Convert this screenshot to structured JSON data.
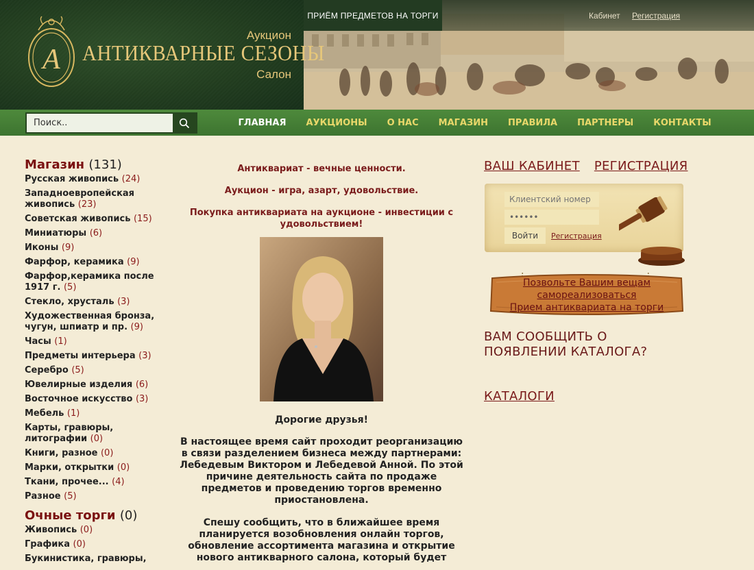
{
  "header": {
    "brand_top": "Аукцион",
    "brand_name": "АНТИКВАРНЫЕ СЕЗОНЫ",
    "brand_bottom": "Салон",
    "auction_link": "ПРИЁМ ПРЕДМЕТОВ НА ТОРГИ",
    "cabinet_link": "Кабинет",
    "register_link": "Регистрация"
  },
  "search": {
    "placeholder": "Поиск.."
  },
  "nav": {
    "items": [
      "ГЛАВНАЯ",
      "АУКЦИОНЫ",
      "О НАС",
      "МАГАЗИН",
      "ПРАВИЛА",
      "ПАРТНЕРЫ",
      "КОНТАКТЫ"
    ]
  },
  "sidebar": {
    "shop": {
      "title": "Магазин",
      "count": "(131)",
      "items": [
        {
          "label": "Русская живопись",
          "count": "(24)"
        },
        {
          "label": "Западноевропейская живопись",
          "count": "(23)"
        },
        {
          "label": "Советская живопись",
          "count": "(15)"
        },
        {
          "label": "Миниатюры",
          "count": "(6)"
        },
        {
          "label": "Иконы",
          "count": "(9)"
        },
        {
          "label": "Фарфор, керамика",
          "count": "(9)"
        },
        {
          "label": "Фарфор,керамика после 1917 г.",
          "count": "(5)"
        },
        {
          "label": "Стекло, хрусталь",
          "count": "(3)"
        },
        {
          "label": "Художественная бронза, чугун, шпиатр и пр.",
          "count": "(9)"
        },
        {
          "label": "Часы",
          "count": "(1)"
        },
        {
          "label": "Предметы интерьера",
          "count": "(3)"
        },
        {
          "label": "Серебро",
          "count": "(5)"
        },
        {
          "label": "Ювелирные изделия",
          "count": "(6)"
        },
        {
          "label": "Восточное искусство",
          "count": "(3)"
        },
        {
          "label": "Мебель",
          "count": "(1)"
        },
        {
          "label": "Карты, гравюры, литографии",
          "count": "(0)"
        },
        {
          "label": "Книги, разное",
          "count": "(0)"
        },
        {
          "label": "Марки, открытки",
          "count": "(0)"
        },
        {
          "label": "Ткани, прочее...",
          "count": "(4)"
        },
        {
          "label": "Разное",
          "count": "(5)"
        }
      ]
    },
    "live": {
      "title": "Очные торги",
      "count": "(0)",
      "items": [
        {
          "label": "Живопись",
          "count": "(0)"
        },
        {
          "label": "Графика",
          "count": "(0)"
        },
        {
          "label": "Букинистика, гравюры,",
          "count": ""
        }
      ]
    }
  },
  "center": {
    "slogan1": "Антиквариат - вечные ценности.",
    "slogan2": "Аукцион - игра, азарт, удовольствие.",
    "slogan3": "Покупка антиквариата на аукционе - инвестиции с удовольствием!",
    "greeting": "Дорогие друзья!",
    "para1": "В настоящее время сайт проходит реорганизацию в связи разделением бизнеса между партнерами: Лебедевым Виктором и Лебедевой Анной. По этой причине деятельность сайта по продаже предметов и проведению торгов временно приостановлена.",
    "para2": "Спешу сообщить, что в ближайшее время планируется возобновления онлайн торгов, обновление ассортимента магазина и открытие нового антикварного салона, который будет"
  },
  "right": {
    "cabinet": "ВАШ КАБИНЕТ",
    "register": "РЕГИСТРАЦИЯ",
    "login_placeholder": "Клиентский номер",
    "password_value": "••••••",
    "login_button": "Войти",
    "login_register": "Регистрация",
    "sign_line1": "Позвольте Вашим вещам",
    "sign_line2": "самореализоваться",
    "sign_line3": "Прием антиквариата на торги",
    "notify": "ВАМ СООБЩИТЬ О ПОЯВЛЕНИИ КАТАЛОГА?",
    "catalogs": "КАТАЛОГИ"
  },
  "colors": {
    "header_green": "#223d1f",
    "nav_green": "#4e8a3c",
    "gold": "#e6c77a",
    "nav_yellow": "#e9d86a",
    "maroon": "#7a1a1a",
    "background": "#f4ecd6"
  }
}
